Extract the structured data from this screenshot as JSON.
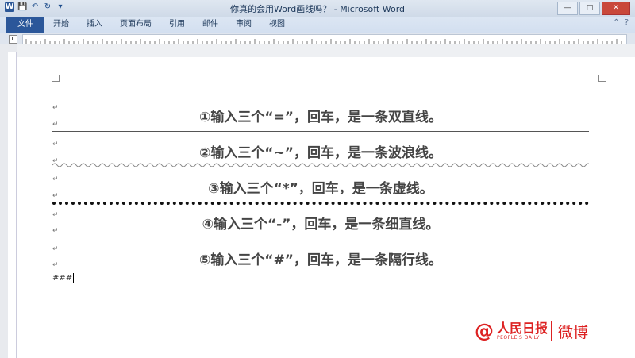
{
  "window": {
    "title": "你真的会用Word画线吗？ - Microsoft Word",
    "minimize": "—",
    "maximize": "□",
    "close": "✕"
  },
  "quick_access": [
    "W",
    "💾",
    "↶",
    "↻",
    "▾"
  ],
  "tabs": [
    {
      "label": "文件"
    },
    {
      "label": "开始"
    },
    {
      "label": "插入"
    },
    {
      "label": "页面布局"
    },
    {
      "label": "引用"
    },
    {
      "label": "邮件"
    },
    {
      "label": "审阅"
    },
    {
      "label": "视图"
    }
  ],
  "ruler": {
    "corner": "L"
  },
  "document": {
    "lines": [
      {
        "text": "①输入三个“=”，回车，是一条双直线。",
        "style": "double"
      },
      {
        "text": "②输入三个“~”，回车，是一条波浪线。",
        "style": "wave"
      },
      {
        "text": "③输入三个“*”，回车，是一条虚线。",
        "style": "dotted"
      },
      {
        "text": "④输入三个“-”，回车，是一条细直线。",
        "style": "single"
      },
      {
        "text": "⑤输入三个“#”，回车，是一条隔行线。",
        "style": "none"
      }
    ],
    "typing": "###",
    "paragraph_mark": "↵"
  },
  "watermark": {
    "at": "@",
    "brand": "人民日报",
    "sub": "PEOPLE'S DAILY",
    "weibo": "微博"
  }
}
